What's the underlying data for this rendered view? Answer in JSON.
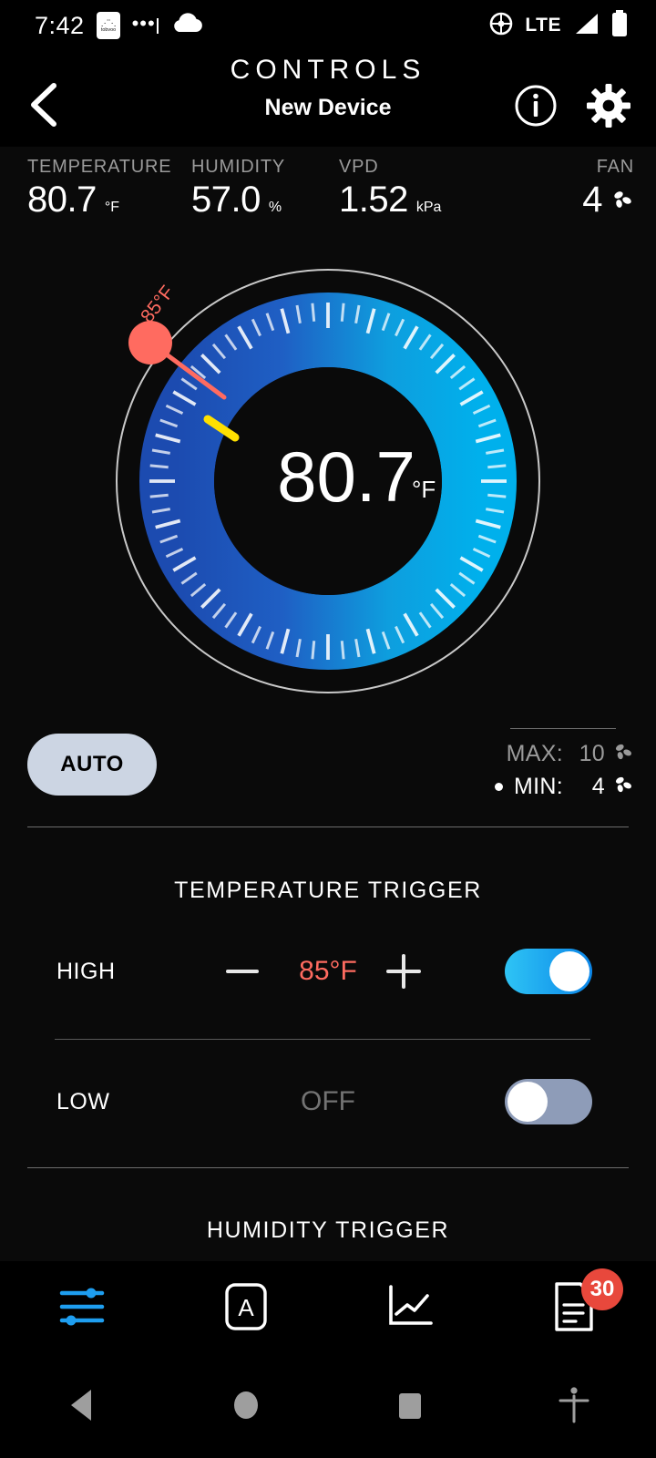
{
  "status_bar": {
    "time": "7:42",
    "app_icon_label": "tobvoo",
    "dots": "•••",
    "cloud_icon": "cloud-icon",
    "gps_icon": "gps-icon",
    "network": "LTE",
    "signal_icon": "signal-bars-icon",
    "battery_icon": "battery-icon"
  },
  "header": {
    "title": "CONTROLS",
    "subtitle": "New Device",
    "back_icon": "back-chevron-icon",
    "info_icon": "info-icon",
    "settings_icon": "gear-icon"
  },
  "metrics": [
    {
      "label": "TEMPERATURE",
      "value": "80.7",
      "unit": "°F"
    },
    {
      "label": "HUMIDITY",
      "value": "57.0",
      "unit": "%"
    },
    {
      "label": "VPD",
      "value": "1.52",
      "unit": "kPa"
    },
    {
      "label": "FAN",
      "value": "4",
      "unit": "fan-icon"
    }
  ],
  "gauge": {
    "reading": "80.7",
    "unit": "°F",
    "thermometer_icon": "thermometer-icon",
    "marker_label": "85°F",
    "marker_value": 85,
    "needle_value": 80.7,
    "range_min": 32,
    "range_max": 130,
    "colors": {
      "ring_start": "#1c4bb0",
      "ring_end": "#00b0ec",
      "marker": "#ff6b60",
      "needle": "#ffe000",
      "outer_ring": "#c9c9c9"
    }
  },
  "auto": {
    "label": "AUTO",
    "max_label": "MAX:",
    "max_value": "10",
    "min_label": "MIN:",
    "min_value": "4",
    "fan_icon": "fan-icon"
  },
  "temperature_trigger": {
    "title": "TEMPERATURE TRIGGER",
    "high": {
      "label": "HIGH",
      "value": "85°F",
      "toggle_on": true,
      "minus_icon": "minus-icon",
      "plus_icon": "plus-icon"
    },
    "low": {
      "label": "LOW",
      "value": "OFF",
      "toggle_on": false
    }
  },
  "humidity_trigger": {
    "title": "HUMIDITY TRIGGER"
  },
  "bottom_nav": [
    {
      "icon": "sliders-icon",
      "active": true,
      "badge": null
    },
    {
      "icon": "auto-box-icon",
      "active": false,
      "badge": null
    },
    {
      "icon": "chart-line-icon",
      "active": false,
      "badge": null
    },
    {
      "icon": "document-icon",
      "active": false,
      "badge": "30"
    }
  ],
  "android_nav": [
    {
      "icon": "back-triangle-icon"
    },
    {
      "icon": "home-circle-icon"
    },
    {
      "icon": "recents-square-icon"
    },
    {
      "icon": "accessibility-icon"
    }
  ]
}
